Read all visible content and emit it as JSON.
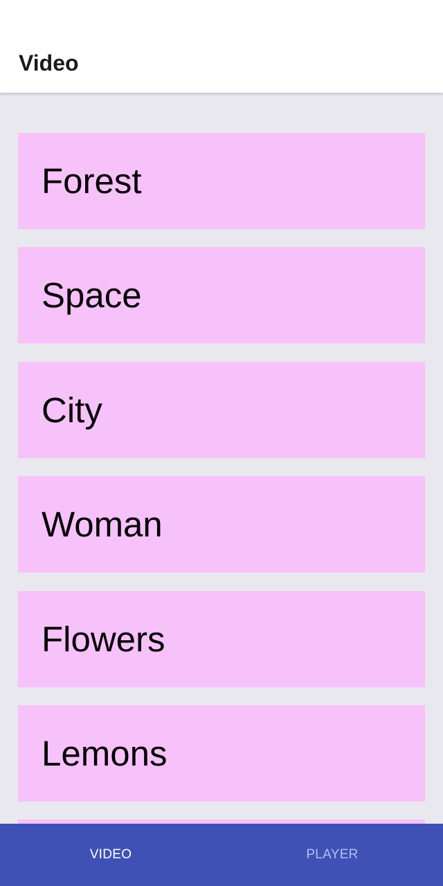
{
  "app_bar": {
    "title": "Video"
  },
  "videos": [
    {
      "label": "Forest"
    },
    {
      "label": "Space"
    },
    {
      "label": "City"
    },
    {
      "label": "Woman"
    },
    {
      "label": "Flowers"
    },
    {
      "label": "Lemons"
    },
    {
      "label": ""
    }
  ],
  "bottom_nav": {
    "items": [
      {
        "label": "VIDEO",
        "selected": true
      },
      {
        "label": "PLAYER",
        "selected": false
      }
    ]
  },
  "colors": {
    "background": "#e9e8ef",
    "item_background": "#f7c1fa",
    "nav_background": "#3f51b5",
    "nav_active_text": "#ffffff",
    "nav_inactive_text": "#b3bdf0"
  }
}
